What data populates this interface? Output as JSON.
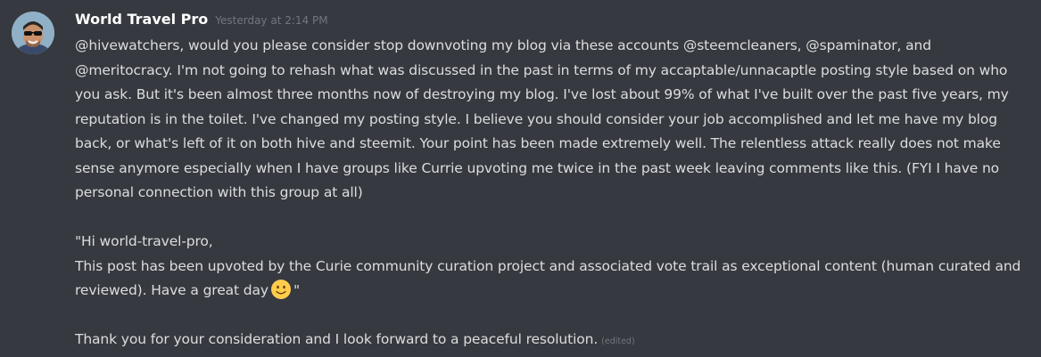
{
  "message": {
    "author": "World Travel Pro",
    "timestamp": "Yesterday at 2:14 PM",
    "paragraph1": "@hivewatchers, would you please consider stop downvoting my blog via these accounts @steemcleaners, @spaminator, and @meritocracy. I'm not going to rehash what was discussed in the past in terms of my accaptable/unnacaptle posting style based on who you ask. But it's been almost three months now of destroying my blog. I've lost about 99% of what I've built over the past five years, my reputation is in the toilet. I've changed my posting style. I believe you should consider your job accomplished and let me have my blog back, or what's left of it on both hive and steemit. Your point has been made extremely well. The relentless attack really does not make sense anymore especially when I have groups like Currie upvoting me twice in the past week leaving comments like this. (FYI I have no personal connection with this group at all)",
    "quote_line1": "\"Hi world-travel-pro,",
    "quote_line2": "This post has been upvoted by the Curie community curation project and associated vote trail as exceptional content (human curated and reviewed). Have a great day",
    "quote_end": "\"",
    "closing": "Thank you for your consideration and I look forward to a peaceful resolution.",
    "edited_label": "(edited)",
    "emoji": "slightly-smiling-face-icon"
  },
  "colors": {
    "background": "#36393f",
    "username": "#ffffff",
    "text": "#dcddde",
    "muted": "#72767d"
  }
}
